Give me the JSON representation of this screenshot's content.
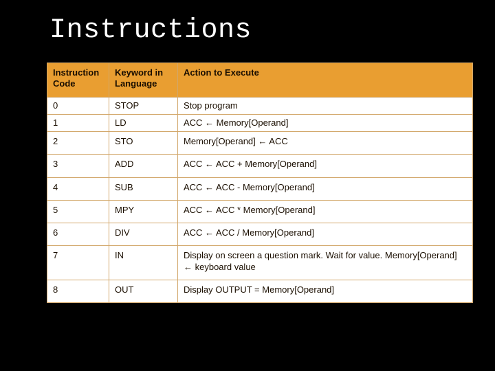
{
  "title": "Instructions",
  "headers": {
    "code": "Instruction Code",
    "keyword": "Keyword in Language",
    "action": "Action to Execute"
  },
  "rows": [
    {
      "code": "0",
      "keyword": "STOP",
      "action": "Stop program"
    },
    {
      "code": "1",
      "keyword": "LD",
      "action": "ACC ← Memory[Operand]"
    },
    {
      "code": "2",
      "keyword": "STO",
      "action": "Memory[Operand] ← ACC"
    },
    {
      "code": "3",
      "keyword": "ADD",
      "action": "ACC ← ACC + Memory[Operand]"
    },
    {
      "code": "4",
      "keyword": "SUB",
      "action": "ACC ← ACC - Memory[Operand]"
    },
    {
      "code": "5",
      "keyword": "MPY",
      "action": "ACC ← ACC * Memory[Operand]"
    },
    {
      "code": "6",
      "keyword": "DIV",
      "action": "ACC ← ACC / Memory[Operand]"
    },
    {
      "code": "7",
      "keyword": "IN",
      "action": "Display on screen a question mark. Wait for value. Memory[Operand] ← keyboard value"
    },
    {
      "code": "8",
      "keyword": "OUT",
      "action": "Display OUTPUT = Memory[Operand]"
    }
  ]
}
